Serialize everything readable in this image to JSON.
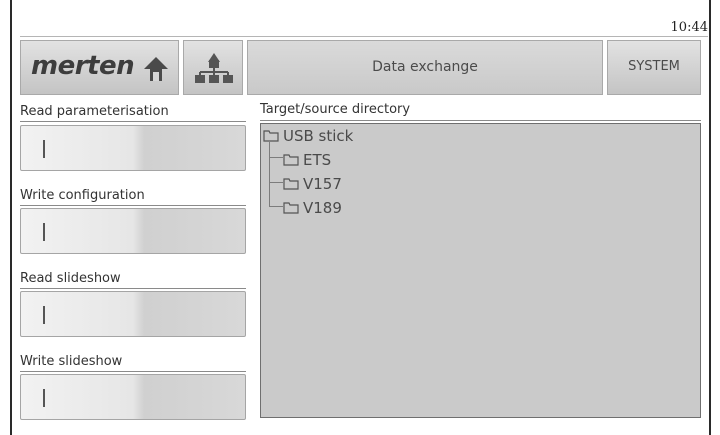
{
  "clock": "10:44",
  "header": {
    "logo_text": "merten",
    "home_icon": "home-arrow-icon",
    "network_icon": "network-tree-icon",
    "title": "Data exchange",
    "system_label": "SYSTEM"
  },
  "actions": [
    {
      "label": "Read parameterisation",
      "button_icon": "cursor-bar-icon"
    },
    {
      "label": "Write configuration",
      "button_icon": "cursor-bar-icon"
    },
    {
      "label": "Read slideshow",
      "button_icon": "cursor-bar-icon"
    },
    {
      "label": "Write slideshow",
      "button_icon": "cursor-bar-icon"
    }
  ],
  "directory": {
    "label": "Target/source directory",
    "root": "USB stick",
    "children": [
      "ETS",
      "V157",
      "V189"
    ]
  },
  "colors": {
    "panel_bg": "#cacaca",
    "header_bg": "#d0d0d0",
    "text": "#3a3a3a"
  }
}
